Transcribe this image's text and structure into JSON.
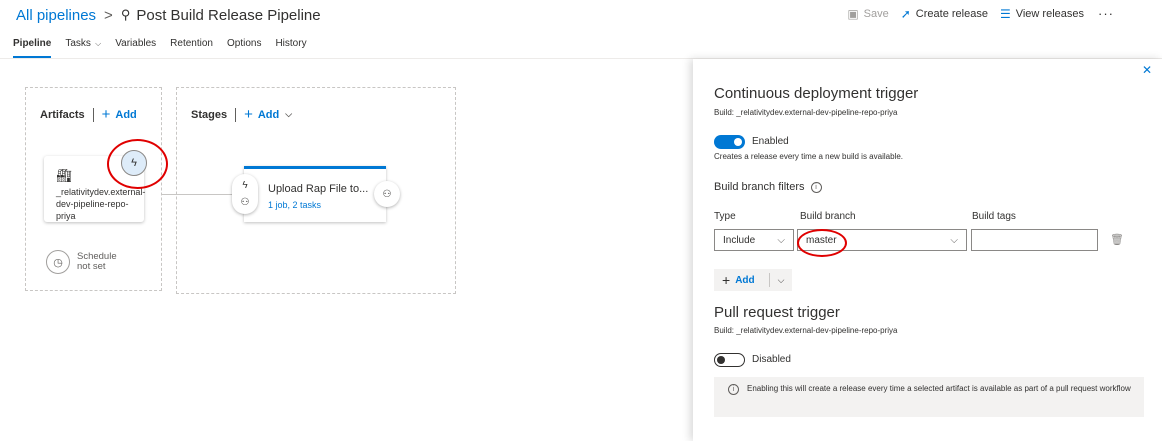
{
  "header": {
    "breadcrumb_link": "All pipelines",
    "breadcrumb_sep": ">",
    "pipeline_icon": "pipeline-icon",
    "pipeline_title": "Post Build Release Pipeline",
    "actions": {
      "save": "Save",
      "create_release": "Create release",
      "view_releases": "View releases",
      "more": "···"
    }
  },
  "tabs": [
    {
      "label": "Pipeline",
      "active": true
    },
    {
      "label": "Tasks",
      "has_dropdown": true
    },
    {
      "label": "Variables"
    },
    {
      "label": "Retention"
    },
    {
      "label": "Options"
    },
    {
      "label": "History"
    }
  ],
  "canvas": {
    "artifacts": {
      "heading": "Artifacts",
      "add_label": "Add",
      "artifact_name": "_relativitydev.external-dev-pipeline-repo-priya",
      "schedule_line1": "Schedule",
      "schedule_line2": "not set"
    },
    "stages": {
      "heading": "Stages",
      "add_label": "Add",
      "stage_title": "Upload Rap File to...",
      "stage_sub": "1 job, 2 tasks"
    }
  },
  "panel": {
    "cd_trigger": {
      "title": "Continuous deployment trigger",
      "build_source": "Build: _relativitydev.external-dev-pipeline-repo-priya",
      "toggle_label": "Enabled",
      "toggle_on": true,
      "description": "Creates a release every time a new build is available."
    },
    "filters": {
      "title": "Build branch filters",
      "col_type": "Type",
      "col_branch": "Build branch",
      "col_tags": "Build tags",
      "type_value": "Include",
      "branch_value": "master",
      "tags_value": "",
      "add_label": "Add"
    },
    "pr_trigger": {
      "title": "Pull request trigger",
      "build_source": "Build: _relativitydev.external-dev-pipeline-repo-priya",
      "toggle_label": "Disabled",
      "toggle_on": false,
      "note": "Enabling this will create a release every time a selected artifact is available as part of a pull request workflow"
    }
  },
  "colors": {
    "accent": "#0078d4",
    "highlight_ring": "#e00000"
  }
}
